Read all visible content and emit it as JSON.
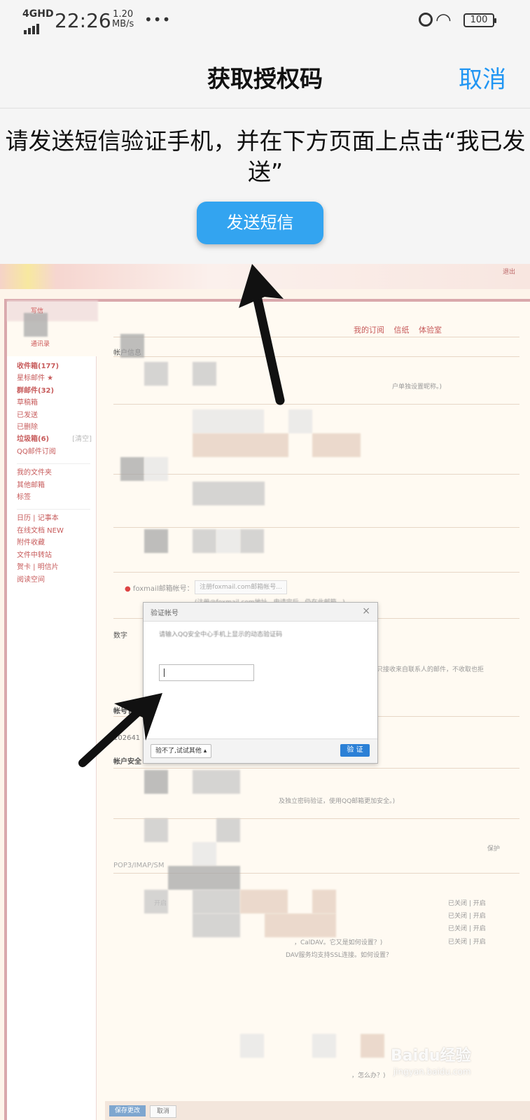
{
  "status_bar": {
    "network": "4GHD",
    "time": "22:26",
    "speed_value": "1.20",
    "speed_unit": "MB/s",
    "more": "•••",
    "battery": "100",
    "icons": [
      "signal-icon",
      "alarm-icon",
      "wifi-icon",
      "battery-icon"
    ]
  },
  "nav": {
    "title": "获取授权码",
    "cancel": "取消"
  },
  "instruction": "请发送短信验证手机，并在下方页面上点击“我已发送”",
  "send_sms_button": "发送短信",
  "screenshot": {
    "top_right": "退出",
    "sidebar": {
      "compose": "写信",
      "contacts": "通讯录",
      "items": [
        "收件箱(177)",
        "星标邮件 ★",
        "群邮件(32)",
        "草稿箱",
        "已发送",
        "已删除",
        "垃圾箱(6)",
        "QQ邮件订阅"
      ],
      "items2": [
        "我的文件夹",
        "其他邮箱",
        "标签"
      ],
      "items3": [
        "日历 | 记事本",
        "在线文档 NEW",
        "附件收藏",
        "文件中转站",
        "贺卡 | 明信片",
        "阅读空间"
      ],
      "clear": "[清空]"
    },
    "tabs": "我的订阅 信纸 体验室",
    "sections": {
      "account_info": "帐户信息",
      "digital": "数字",
      "account_mgmt": "帐号管",
      "account_security": "帐户安全",
      "pop": "POP3/IMAP/SM"
    },
    "account_number": "102641",
    "notes": {
      "nickname_note": "户单独设置昵称。)",
      "foxmail": "foxmail邮箱帐号：",
      "foxmail_btn": "注册foxmail.com邮箱帐号...",
      "foxmail_hint": "(注册@foxmail.com地址，申请完后，仍在此邮箱...)",
      "right_note": "只接收来自联系人的邮件，不收取也拒",
      "security_note": "及独立密码验证，使用QQ邮箱更加安全。)",
      "protect": "保护",
      "imap_note": "，CalDAV。它又是如何设置？)",
      "ssl_note": "DAV服务均支持SSL连接。如何设置？",
      "bottom_note": "，怎么办？)",
      "start": "开启",
      "toggles": [
        "已关闭 | 开启",
        "已关闭 | 开启",
        "已关闭 | 开启",
        "已关闭 | 开启"
      ]
    },
    "dialog": {
      "title": "验证帐号",
      "hint": "请输入QQ安全中心手机上显示的动态验证码",
      "other_btn": "验不了,试试其他 ▴",
      "verify_btn": "验 证",
      "close": "×"
    },
    "bottom_bar": {
      "save": "保存更改",
      "back": "取消"
    }
  },
  "watermark": {
    "brand": "Baidu经验",
    "url": "jingyan.baidu.com"
  },
  "colors": {
    "accent": "#2196f3",
    "button": "#33a4f0",
    "mail_red": "#c75b5b"
  }
}
